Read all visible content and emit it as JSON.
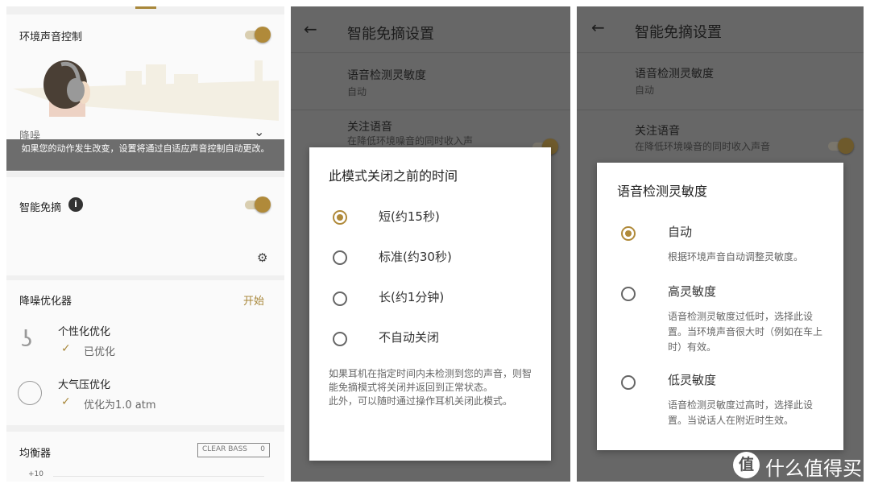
{
  "panel1": {
    "ambient_title": "环境声音控制",
    "ambient_on": true,
    "mode_label": "降噪",
    "toast": "如果您的动作发生改变，设置将通过自适应声音控制自动更改。",
    "smart_talk_title": "智能免摘",
    "smart_talk_on": true,
    "optimizer_title": "降噪优化器",
    "optimizer_start": "开始",
    "personal_title": "个性化优化",
    "personal_status": "已优化",
    "pressure_title": "大气压优化",
    "pressure_status": "优化为1.0 atm",
    "eq_title": "均衡器",
    "clear_bass_label": "CLEAR BASS",
    "clear_bass_value": "0",
    "eq_tick": "+10"
  },
  "panel2": {
    "header_title": "智能免摘设置",
    "row1_title": "语音检测灵敏度",
    "row1_value": "自动",
    "row2_title": "关注语音",
    "row2_sub": "在降低环境噪音的同时收入声",
    "dialog_title": "此模式关闭之前的时间",
    "options": [
      {
        "label": "短(约15秒)",
        "selected": true
      },
      {
        "label": "标准(约30秒)",
        "selected": false
      },
      {
        "label": "长(约1分钟)",
        "selected": false
      },
      {
        "label": "不自动关闭",
        "selected": false
      }
    ],
    "note": "如果耳机在指定时间内未检测到您的声音，则智能免摘模式将关闭并返回到正常状态。\n此外，可以随时通过操作耳机关闭此模式。"
  },
  "panel3": {
    "header_title": "智能免摘设置",
    "row1_title": "语音检测灵敏度",
    "row1_value": "自动",
    "row2_title": "关注语音",
    "row2_sub": "在降低环境噪音的同时收入声音",
    "dialog_title": "语音检测灵敏度",
    "options": [
      {
        "label": "自动",
        "desc": "根据环境声音自动调整灵敏度。",
        "selected": true
      },
      {
        "label": "高灵敏度",
        "desc": "语音检测灵敏度过低时，选择此设置。当环境声音很大时（例如在车上时）有效。",
        "selected": false
      },
      {
        "label": "低灵敏度",
        "desc": "语音检测灵敏度过高时，选择此设置。当说话人在附近时生效。",
        "selected": false
      }
    ]
  },
  "watermark": {
    "badge": "值",
    "text": "什么值得买"
  },
  "colors": {
    "accent": "#b08a3a",
    "toast_bg": "#6d6d6d",
    "overlay": "#6a6a6a"
  }
}
